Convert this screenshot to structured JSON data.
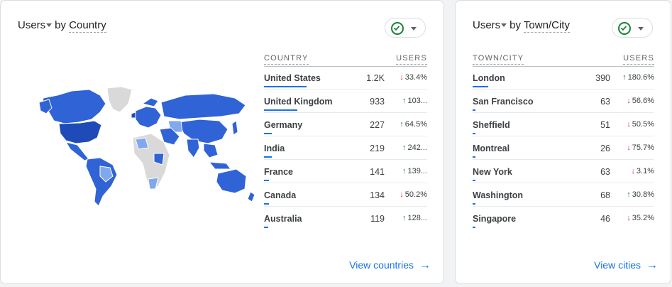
{
  "country_card": {
    "title_metric": "Users",
    "title_by": "by",
    "title_dimension": "Country",
    "col_dimension": "COUNTRY",
    "col_metric": "USERS",
    "rows": [
      {
        "name": "United States",
        "value": "1.2K",
        "direction": "down",
        "change": "33.4%",
        "share": 1.0
      },
      {
        "name": "United Kingdom",
        "value": "933",
        "direction": "up",
        "change": "103...",
        "share": 0.78
      },
      {
        "name": "Germany",
        "value": "227",
        "direction": "up",
        "change": "64.5%",
        "share": 0.19
      },
      {
        "name": "India",
        "value": "219",
        "direction": "up",
        "change": "242...",
        "share": 0.18
      },
      {
        "name": "France",
        "value": "141",
        "direction": "up",
        "change": "139...",
        "share": 0.12
      },
      {
        "name": "Canada",
        "value": "134",
        "direction": "down",
        "change": "50.2%",
        "share": 0.11
      },
      {
        "name": "Australia",
        "value": "119",
        "direction": "up",
        "change": "128...",
        "share": 0.1
      }
    ],
    "link_label": "View countries"
  },
  "city_card": {
    "title_metric": "Users",
    "title_by": "by",
    "title_dimension": "Town/City",
    "col_dimension": "TOWN/CITY",
    "col_metric": "USERS",
    "rows": [
      {
        "name": "London",
        "value": "390",
        "direction": "up",
        "change": "180.6%",
        "share": 1.0
      },
      {
        "name": "San Francisco",
        "value": "63",
        "direction": "down",
        "change": "56.6%",
        "share": 0.16
      },
      {
        "name": "Sheffield",
        "value": "51",
        "direction": "down",
        "change": "50.5%",
        "share": 0.13
      },
      {
        "name": "Montreal",
        "value": "26",
        "direction": "down",
        "change": "75.7%",
        "share": 0.07
      },
      {
        "name": "New York",
        "value": "63",
        "direction": "down",
        "change": "3.1%",
        "share": 0.16
      },
      {
        "name": "Washington",
        "value": "68",
        "direction": "up",
        "change": "30.8%",
        "share": 0.17
      },
      {
        "name": "Singapore",
        "value": "46",
        "direction": "down",
        "change": "35.2%",
        "share": 0.12
      }
    ],
    "link_label": "View cities"
  },
  "colors": {
    "accent": "#1a73e8",
    "up": "#188038",
    "down": "#d93025",
    "map_dark": "#1f4bb8",
    "map_mid": "#2f63d6",
    "map_light": "#7fa8ee",
    "map_none": "#d9d9d9"
  },
  "icons": {
    "status": "check-circle-icon",
    "dropdown": "chevron-down-icon",
    "link": "arrow-right-icon"
  }
}
